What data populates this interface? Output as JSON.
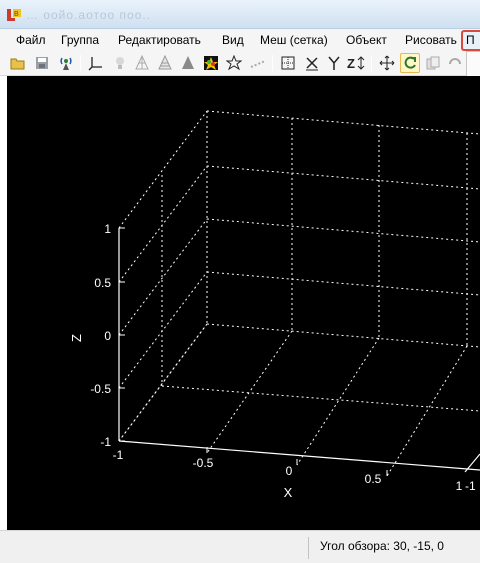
{
  "window": {
    "title_fragment": "…  ooйo.аотоо поо.."
  },
  "menu": {
    "items": [
      {
        "label": "Файл",
        "name": "menu-file"
      },
      {
        "label": "Группа",
        "name": "menu-group"
      },
      {
        "label": "Редактировать",
        "name": "menu-edit"
      },
      {
        "label": "Вид",
        "name": "menu-view"
      },
      {
        "label": "Меш (сетка)",
        "name": "menu-mesh"
      },
      {
        "label": "Объект",
        "name": "menu-object"
      },
      {
        "label": "Рисовать",
        "name": "menu-draw"
      }
    ],
    "highlighted_label": "П"
  },
  "toolbar": {
    "buttons": [
      {
        "icon": "open-folder-icon"
      },
      {
        "icon": "save-icon"
      },
      {
        "icon": "signal-icon"
      },
      {
        "icon": "axes-icon"
      },
      {
        "icon": "light-icon"
      },
      {
        "icon": "wire-cone-icon"
      },
      {
        "icon": "mesh-cone-icon"
      },
      {
        "icon": "solid-cone-icon"
      },
      {
        "icon": "colormap-icon"
      },
      {
        "icon": "star-icon"
      },
      {
        "icon": "dash-line-icon"
      },
      {
        "icon": "box-icon"
      },
      {
        "icon": "view-x-icon"
      },
      {
        "icon": "view-xy-icon"
      },
      {
        "icon": "zoom-z-icon"
      },
      {
        "icon": "pan-icon"
      },
      {
        "icon": "rotate-icon",
        "active": true
      },
      {
        "icon": "copy-icon"
      },
      {
        "icon": "undo-icon"
      }
    ]
  },
  "plot": {
    "z_ticks": [
      "1",
      "0.5",
      "0",
      "-0.5",
      "-1"
    ],
    "x_ticks": [
      "-1",
      "-0.5",
      "0",
      "0.5",
      "1"
    ],
    "y_tick_partial": "-1",
    "xlabel": "X",
    "zlabel": "Z",
    "colors": {
      "background": "#000000",
      "axis": "#ffffff",
      "grid": "#ffffff"
    }
  },
  "status": {
    "view_angle": "Угол обзора: 30, -15, 0"
  }
}
